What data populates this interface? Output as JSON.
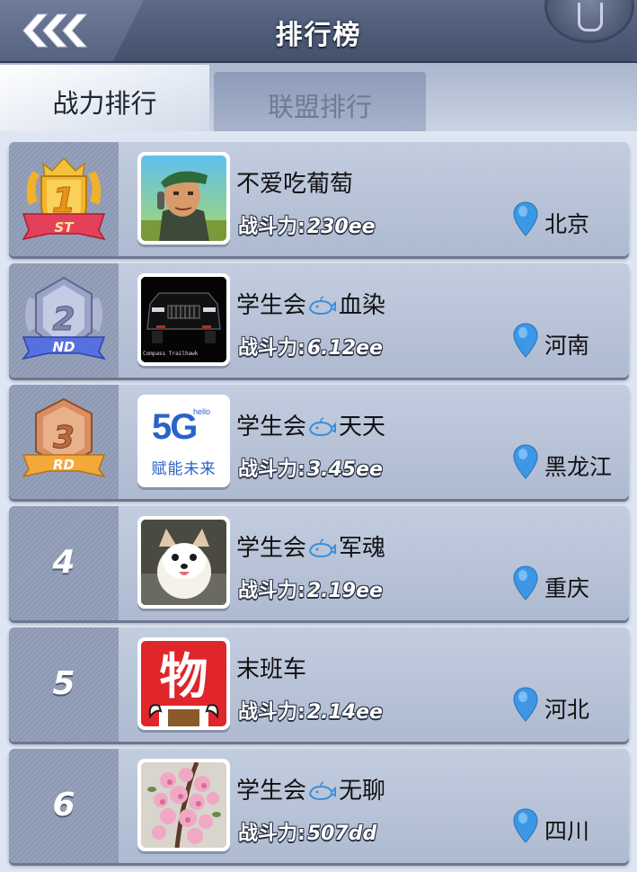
{
  "header": {
    "title": "排行榜"
  },
  "tabs": [
    {
      "label": "战力排行",
      "active": true
    },
    {
      "label": "联盟排行",
      "active": false
    }
  ],
  "power_label": "战斗力:",
  "club_prefix": "学生会",
  "colors": {
    "header_bg": "#4f5b78",
    "row_bg": "#b8c3d8",
    "pin_blue": "#3c97e6",
    "gold": "#f2b12b",
    "silver": "#9aa4c6",
    "bronze": "#d98d62"
  },
  "rankings": [
    {
      "rank": "1",
      "medal": "gold",
      "medal_text": "1",
      "medal_suffix": "ST",
      "name": "不爱吃葡萄",
      "club": false,
      "power": "230ee",
      "city": "北京",
      "avatar": "soldier-avatar"
    },
    {
      "rank": "2",
      "medal": "silver",
      "medal_text": "2",
      "medal_suffix": "ND",
      "name": "血染",
      "club": true,
      "power": "6.12ee",
      "city": "河南",
      "avatar": "jeep-avatar",
      "avatar_caption": "Compass Trailhawk"
    },
    {
      "rank": "3",
      "medal": "bronze",
      "medal_text": "3",
      "medal_suffix": "RD",
      "name": "天天",
      "club": true,
      "power": "3.45ee",
      "city": "黑龙江",
      "avatar": "5g-avatar",
      "avatar_logo": "5G",
      "avatar_small": "hello",
      "avatar_caption": "赋能未来"
    },
    {
      "rank": "4",
      "name": "军魂",
      "club": true,
      "power": "2.19ee",
      "city": "重庆",
      "avatar": "dog-avatar"
    },
    {
      "rank": "5",
      "name": "末班车",
      "club": false,
      "power": "2.14ee",
      "city": "河北",
      "avatar": "wu-avatar",
      "avatar_logo": "物"
    },
    {
      "rank": "6",
      "name": "无聊",
      "club": true,
      "power": "507dd",
      "city": "四川",
      "avatar": "flowers-avatar"
    }
  ]
}
